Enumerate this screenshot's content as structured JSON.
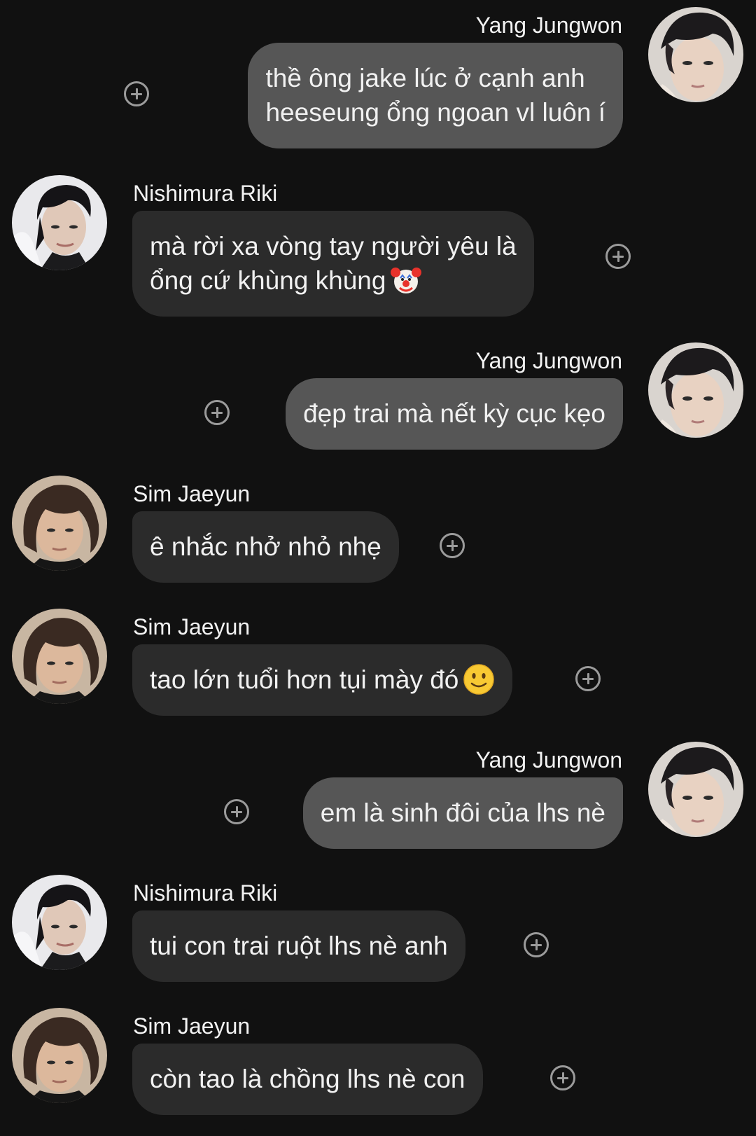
{
  "colors": {
    "background": "#111111",
    "incoming_bubble": "#2b2b2b",
    "outgoing_bubble": "#565656",
    "text": "#f1f1f1",
    "add_icon": "#9b9b9b"
  },
  "messages": [
    {
      "sender": "Yang Jungwon",
      "lines": [
        "thề ông jake lúc ở cạnh anh",
        "heeseung ổng ngoan vl luôn í"
      ],
      "avatar": "avatar-yang-jungwon"
    },
    {
      "sender": "Nishimura Riki",
      "lines": [
        "mà rời xa vòng tay người yêu là",
        "ổng cứ khùng khùng"
      ],
      "emoji": "clown-face-emoji",
      "avatar": "avatar-nishimura-riki"
    },
    {
      "sender": "Yang Jungwon",
      "lines": [
        "đẹp trai mà nết kỳ cục kẹo"
      ],
      "avatar": "avatar-yang-jungwon"
    },
    {
      "sender": "Sim Jaeyun",
      "lines": [
        "ê nhắc nhở nhỏ nhẹ"
      ],
      "avatar": "avatar-sim-jaeyun"
    },
    {
      "sender": "Sim Jaeyun",
      "lines": [
        "tao lớn tuổi hơn tụi mày đó"
      ],
      "emoji": "slightly-smiling-face-emoji",
      "avatar": "avatar-sim-jaeyun"
    },
    {
      "sender": "Yang Jungwon",
      "lines": [
        "em là sinh đôi của lhs nè"
      ],
      "avatar": "avatar-yang-jungwon"
    },
    {
      "sender": "Nishimura Riki",
      "lines": [
        "tui con trai ruột lhs nè anh"
      ],
      "avatar": "avatar-nishimura-riki"
    },
    {
      "sender": "Sim Jaeyun",
      "lines": [
        "còn tao là chồng lhs nè con"
      ],
      "avatar": "avatar-sim-jaeyun"
    }
  ],
  "icons": {
    "add_reaction": "add-reaction-icon"
  }
}
